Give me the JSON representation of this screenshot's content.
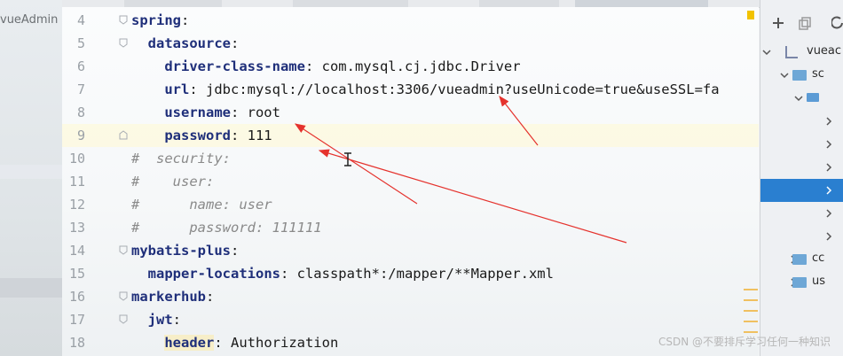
{
  "left_panel": {
    "project_label": "vueAdmin"
  },
  "editor": {
    "lines": [
      {
        "n": "4",
        "indent": "",
        "key": "spring",
        "rest": ":",
        "type": "key"
      },
      {
        "n": "5",
        "indent": "  ",
        "key": "datasource",
        "rest": ":",
        "type": "key"
      },
      {
        "n": "6",
        "indent": "    ",
        "key": "driver-class-name",
        "rest": ": com.mysql.cj.jdbc.Driver",
        "type": "key"
      },
      {
        "n": "7",
        "indent": "    ",
        "key": "url",
        "rest": ": jdbc:mysql://localhost:3306/vueadmin?useUnicode=true&useSSL=fa",
        "type": "key"
      },
      {
        "n": "8",
        "indent": "    ",
        "key": "username",
        "rest": ": root",
        "type": "key"
      },
      {
        "n": "9",
        "indent": "    ",
        "key": "password",
        "rest": ": 111",
        "type": "key",
        "current": true
      },
      {
        "n": "10",
        "text": "#  security:",
        "type": "comment"
      },
      {
        "n": "11",
        "text": "#    user:",
        "type": "comment"
      },
      {
        "n": "12",
        "text": "#      name: user",
        "type": "comment"
      },
      {
        "n": "13",
        "text": "#      password: 111111",
        "type": "comment"
      },
      {
        "n": "14",
        "indent": "",
        "key": "mybatis-plus",
        "rest": ":",
        "type": "key"
      },
      {
        "n": "15",
        "indent": "  ",
        "key": "mapper-locations",
        "rest": ": classpath*:/mapper/**Mapper.xml",
        "type": "key"
      },
      {
        "n": "16",
        "indent": "",
        "key": "markerhub",
        "rest": ":",
        "type": "key"
      },
      {
        "n": "17",
        "indent": "  ",
        "key": "jwt",
        "rest": ":",
        "type": "key"
      },
      {
        "n": "18",
        "indent": "    ",
        "key": "header",
        "rest": ": Authorization",
        "type": "key",
        "highlight": true
      }
    ]
  },
  "right_panel": {
    "items": [
      {
        "label": "vueac",
        "kind": "project"
      },
      {
        "label": "sc",
        "kind": "folder"
      },
      {
        "label": "",
        "kind": "package"
      },
      {
        "label": "",
        "kind": "chevron"
      },
      {
        "label": "",
        "kind": "chevron"
      },
      {
        "label": "",
        "kind": "chevron"
      },
      {
        "label": "",
        "kind": "chevron-selected"
      },
      {
        "label": "",
        "kind": "chevron"
      },
      {
        "label": "",
        "kind": "chevron"
      },
      {
        "label": "cc",
        "kind": "folder"
      },
      {
        "label": "us",
        "kind": "folder"
      }
    ]
  },
  "watermark": "CSDN @不要排斥学习任何一种知识",
  "colors": {
    "key": "#1f2f7a",
    "comment": "#8a8a8a",
    "arrow": "#e5322d",
    "selection": "#2a7fd0"
  },
  "icons": [
    "plus-icon",
    "copy-icon",
    "refresh-icon",
    "fold-marker-icon",
    "text-cursor-icon",
    "chevron-right-icon",
    "chevron-down-icon",
    "folder-icon"
  ]
}
